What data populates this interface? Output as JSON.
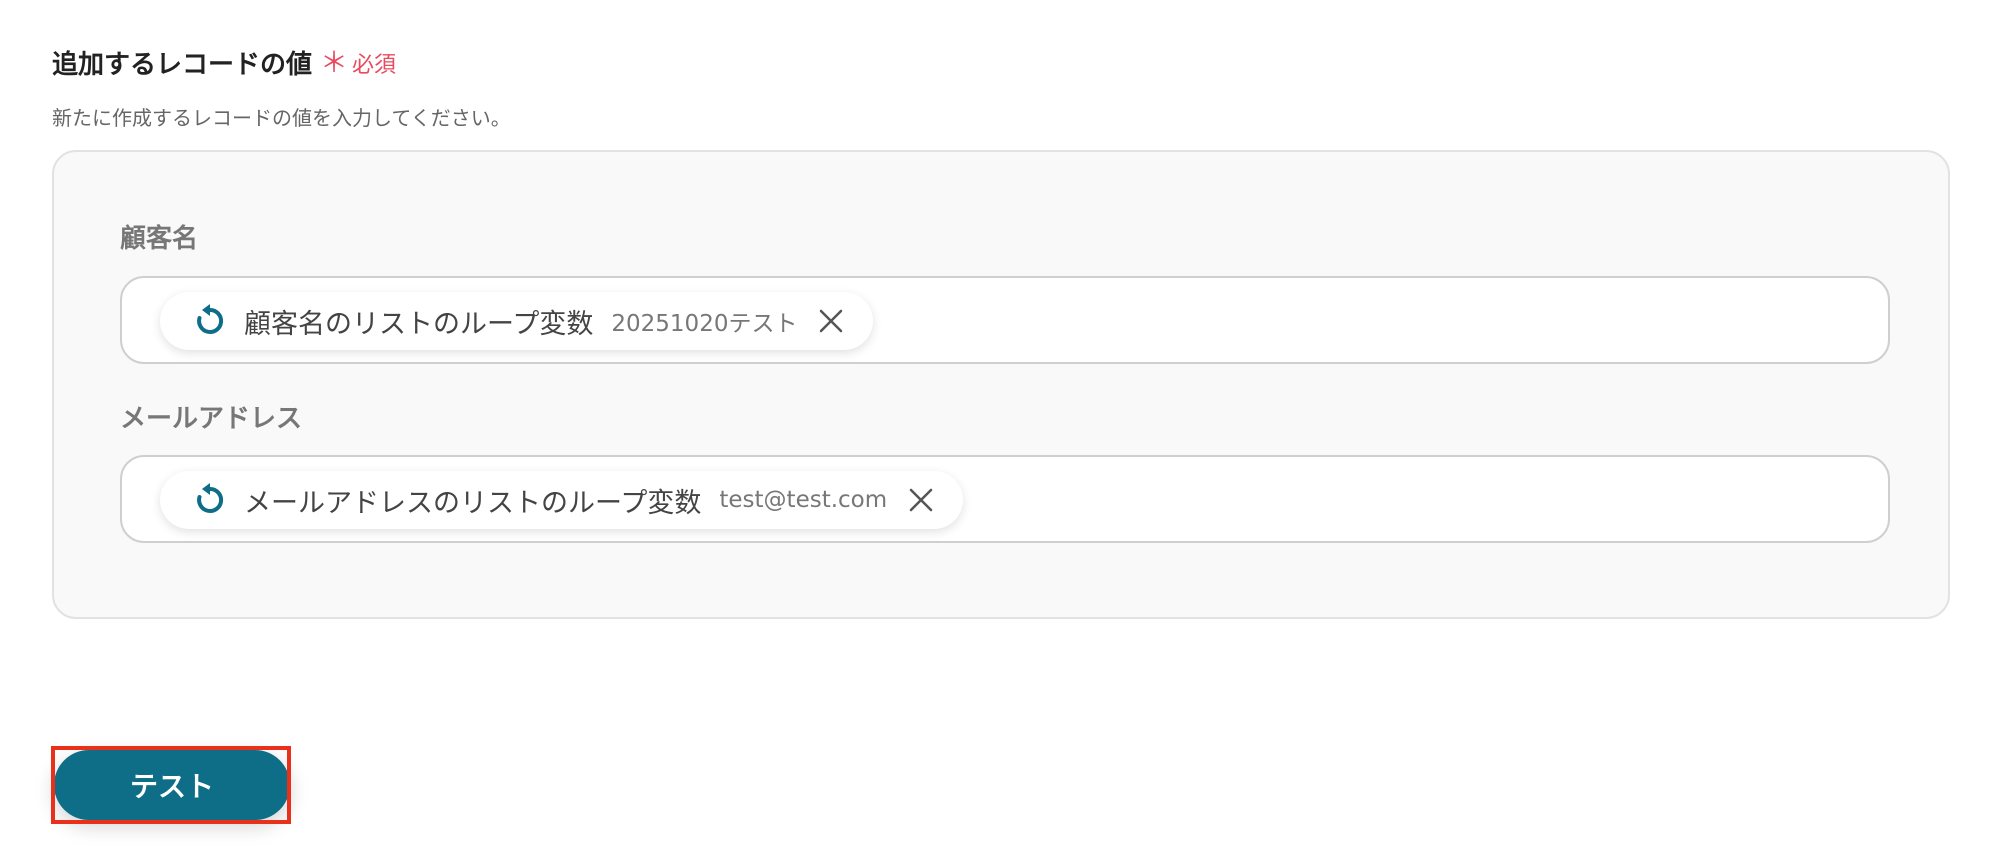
{
  "section": {
    "title": "追加するレコードの値",
    "required_label": "必須",
    "required_mark": "＊",
    "description": "新たに作成するレコードの値を入力してください。"
  },
  "fields": [
    {
      "label": "顧客名",
      "chip_label": "顧客名のリストのループ変数",
      "chip_value": "20251020テスト",
      "chip_icon": "loop-icon"
    },
    {
      "label": "メールアドレス",
      "chip_label": "メールアドレスのリストのループ変数",
      "chip_value": "test@test.com",
      "chip_icon": "loop-icon"
    }
  ],
  "test_button": {
    "label": "テスト"
  },
  "colors": {
    "accent": "#0e6d87",
    "required": "#e84a5f",
    "highlight": "#e8301a"
  }
}
